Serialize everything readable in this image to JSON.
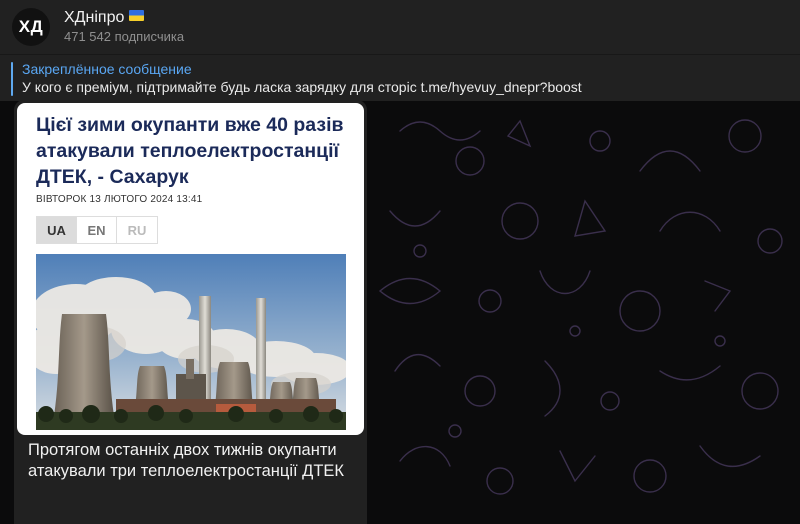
{
  "channel": {
    "avatar_text": "ХД",
    "name": "ХДніпро",
    "subscribers": "471 542 подписчика"
  },
  "pinned": {
    "title": "Закреплённое сообщение",
    "text": "У кого є преміум, підтримайте будь ласка зарядку для сторіс t.me/hyevuy_dnepr?boost"
  },
  "post": {
    "article_title": "Цієї зими окупанти вже 40 разів атакували теплоелектростанції ДТЕК, - Сахарук",
    "article_date": "ВІВТОРОК 13 ЛЮТОГО 2024 13:41",
    "langs": [
      "UA",
      "EN",
      "RU"
    ],
    "caption": "Протягом останніх двох тижнів окупанти атакували три теплоелектростанції ДТЕК"
  },
  "colors": {
    "accent": "#5aa7f3",
    "header_bg": "#212121",
    "title_blue": "#1b2a59"
  },
  "icons": {
    "flag": "ukraine-flag-icon",
    "photo": "power-plant-photo"
  }
}
